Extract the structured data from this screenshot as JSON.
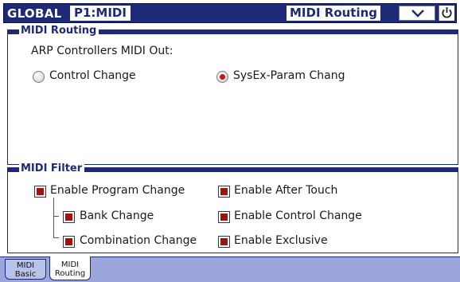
{
  "header": {
    "mode": "GLOBAL",
    "page": "P1:MIDI",
    "section": "MIDI Routing"
  },
  "routing": {
    "title": "MIDI Routing",
    "label": "ARP Controllers MIDI Out:",
    "options": [
      {
        "label": "Control Change",
        "selected": false
      },
      {
        "label": "SysEx-Param Chang",
        "selected": true
      }
    ]
  },
  "filter": {
    "title": "MIDI Filter",
    "items": [
      {
        "label": "Enable Program Change",
        "checked": true
      },
      {
        "label": "Bank Change",
        "checked": true
      },
      {
        "label": "Combination Change",
        "checked": true
      },
      {
        "label": "Enable After Touch",
        "checked": true
      },
      {
        "label": "Enable Control Change",
        "checked": true
      },
      {
        "label": "Enable Exclusive",
        "checked": true
      }
    ]
  },
  "tabs": [
    {
      "line1": "MIDI",
      "line2": "Basic",
      "active": false
    },
    {
      "line1": "MIDI",
      "line2": "Routing",
      "active": true
    }
  ],
  "icons": {
    "menu": "chevron-down-icon",
    "power": "power-icon"
  },
  "colors": {
    "accent": "#1c2a78",
    "tab_strip": "#9aa6dc",
    "check_fill": "#9c1414",
    "radio_dot": "#c41a14"
  }
}
